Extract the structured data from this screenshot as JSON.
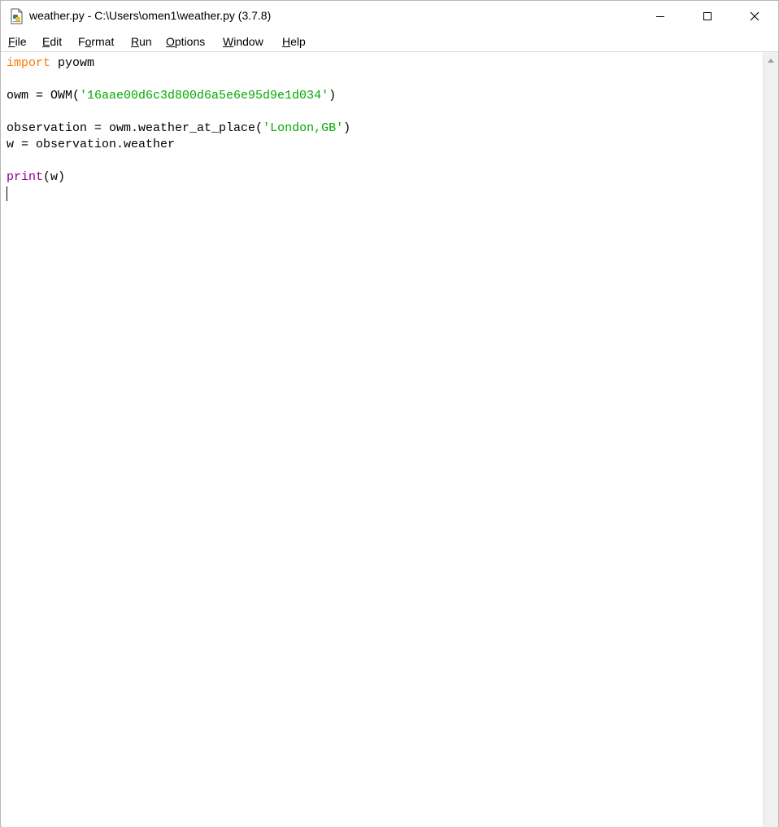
{
  "window": {
    "title": "weather.py - C:\\Users\\omen1\\weather.py (3.7.8)"
  },
  "icons": {
    "app": "python-file-icon",
    "minimize": "minimize-icon",
    "maximize": "maximize-icon",
    "close": "close-icon",
    "scroll_up": "scroll-up-arrow-icon"
  },
  "menu": [
    {
      "mnemonic": "F",
      "rest": "ile"
    },
    {
      "mnemonic": "E",
      "rest": "dit"
    },
    {
      "pre": "F",
      "mnemonic": "o",
      "rest": "rmat"
    },
    {
      "mnemonic": "R",
      "rest": "un"
    },
    {
      "mnemonic": "O",
      "rest": "ptions"
    },
    {
      "mnemonic": "W",
      "rest": "indow"
    },
    {
      "mnemonic": "H",
      "rest": "elp"
    }
  ],
  "code": {
    "line1": {
      "keyword": "import",
      "rest": " pyowm"
    },
    "line3": {
      "pre": "owm = OWM(",
      "string": "'16aae00d6c3d800d6a5e6e95d9e1d034'",
      "post": ")"
    },
    "line5": {
      "pre": "observation = owm.weather_at_place(",
      "string": "'London,GB'",
      "post": ")"
    },
    "line6": {
      "text": "w = observation.weather"
    },
    "line8": {
      "builtin": "print",
      "rest": "(w)"
    }
  },
  "colors": {
    "keyword": "#ff7700",
    "builtin": "#900090",
    "string": "#00aa00",
    "text": "#000000"
  }
}
